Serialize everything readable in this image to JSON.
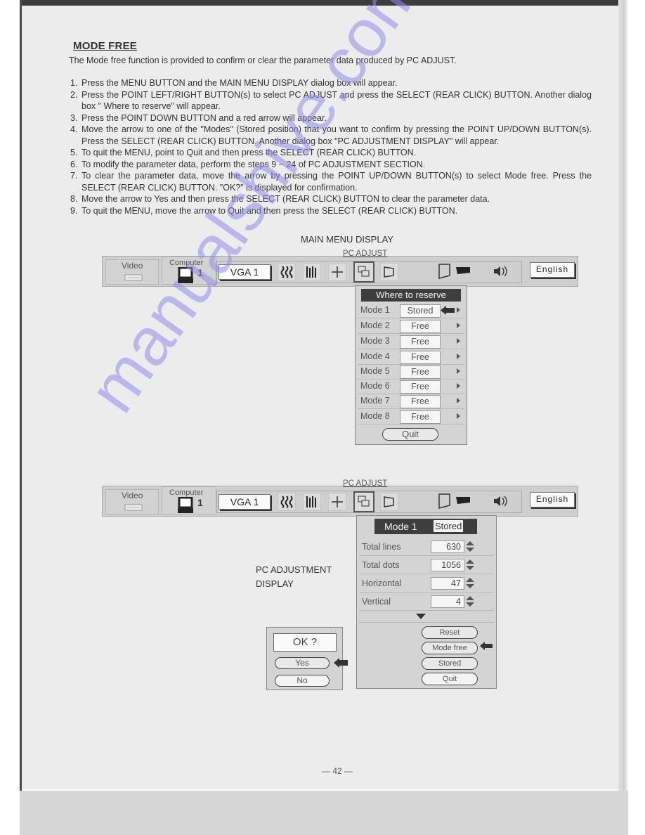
{
  "document": {
    "title": "MODE FREE",
    "intro": "The Mode free function is provided to confirm or clear the parameter data produced by PC ADJUST.",
    "steps": [
      {
        "num": "1.",
        "text": "Press the MENU BUTTON and the MAIN MENU DISPLAY dialog box will appear."
      },
      {
        "num": "2.",
        "text": "Press the POINT LEFT/RIGHT BUTTON(s) to select PC ADJUST and press the SELECT (REAR CLICK) BUTTON. Another dialog box \" Where to reserve\" will appear."
      },
      {
        "num": "3.",
        "text": "Press the POINT DOWN BUTTON and a red arrow will appear."
      },
      {
        "num": "4.",
        "text": "Move the arrow to one of the \"Modes\" (Stored position) that you want to confirm by pressing the POINT UP/DOWN BUTTON(s). Press the SELECT (REAR CLICK) BUTTON. Another dialog box \"PC ADJUSTMENT DISPLAY\" will appear."
      },
      {
        "num": "5.",
        "text": "To quit the MENU, point to Quit and then press the SELECT (REAR CLICK) BUTTON."
      },
      {
        "num": "6.",
        "text": "To modify the parameter data, perform the steps 9 ~ 24 of PC ADJUSTMENT SECTION."
      },
      {
        "num": "7.",
        "text": "To clear the parameter data, move the arrow by pressing the POINT UP/DOWN BUTTON(s) to select Mode free. Press the SELECT (REAR CLICK) BUTTON. \"OK?\" is displayed for confirmation."
      },
      {
        "num": "8.",
        "text": "Move the arrow to Yes and then press the SELECT (REAR CLICK) BUTTON to clear the parameter data."
      },
      {
        "num": "9.",
        "text": "To quit the MENU, move the arrow to Quit and then press the SELECT (REAR CLICK) BUTTON."
      }
    ],
    "page_number": "— 42 —"
  },
  "figure1": {
    "caption": "MAIN MENU DISPLAY",
    "menubar": {
      "video_label": "Video",
      "computer_label": "Computer",
      "computer_number": "1",
      "source_value": "VGA 1",
      "section_label": "PC ADJUST",
      "language_value": "English",
      "icons": [
        "image-adjust-icon",
        "image-level-icon",
        "position-icon",
        "pc-adjust-icon",
        "keystone-icon",
        "screen-icon",
        "projector-icon",
        "sound-icon"
      ]
    },
    "where_to_reserve": {
      "title": "Where to reserve",
      "modes": [
        {
          "label": "Mode 1",
          "value": "Stored",
          "pointer": true
        },
        {
          "label": "Mode 2",
          "value": "Free"
        },
        {
          "label": "Mode 3",
          "value": "Free"
        },
        {
          "label": "Mode 4",
          "value": "Free"
        },
        {
          "label": "Mode 5",
          "value": "Free"
        },
        {
          "label": "Mode 6",
          "value": "Free"
        },
        {
          "label": "Mode 7",
          "value": "Free"
        },
        {
          "label": "Mode 8",
          "value": "Free"
        }
      ],
      "quit_label": "Quit"
    }
  },
  "figure2": {
    "caption_line1": "PC ADJUSTMENT",
    "caption_line2": "DISPLAY",
    "menubar": {
      "video_label": "Video",
      "computer_label": "Computer",
      "computer_number": "1",
      "source_value": "VGA 1",
      "section_label": "PC ADJUST",
      "language_value": "English"
    },
    "adjustment": {
      "mode_label": "Mode 1",
      "mode_status": "Stored",
      "rows": [
        {
          "label": "Total lines",
          "value": "630"
        },
        {
          "label": "Total dots",
          "value": "1056"
        },
        {
          "label": "Horizontal",
          "value": "47"
        },
        {
          "label": "Vertical",
          "value": "4"
        }
      ],
      "buttons": [
        "Reset",
        "Mode free",
        "Stored",
        "Quit"
      ],
      "pointer_on": "Mode free"
    },
    "confirm": {
      "prompt": "OK ?",
      "yes_label": "Yes",
      "no_label": "No",
      "pointer_on": "Yes"
    }
  },
  "watermark": {
    "text": "manualshive.com",
    "color": "#968cea"
  }
}
